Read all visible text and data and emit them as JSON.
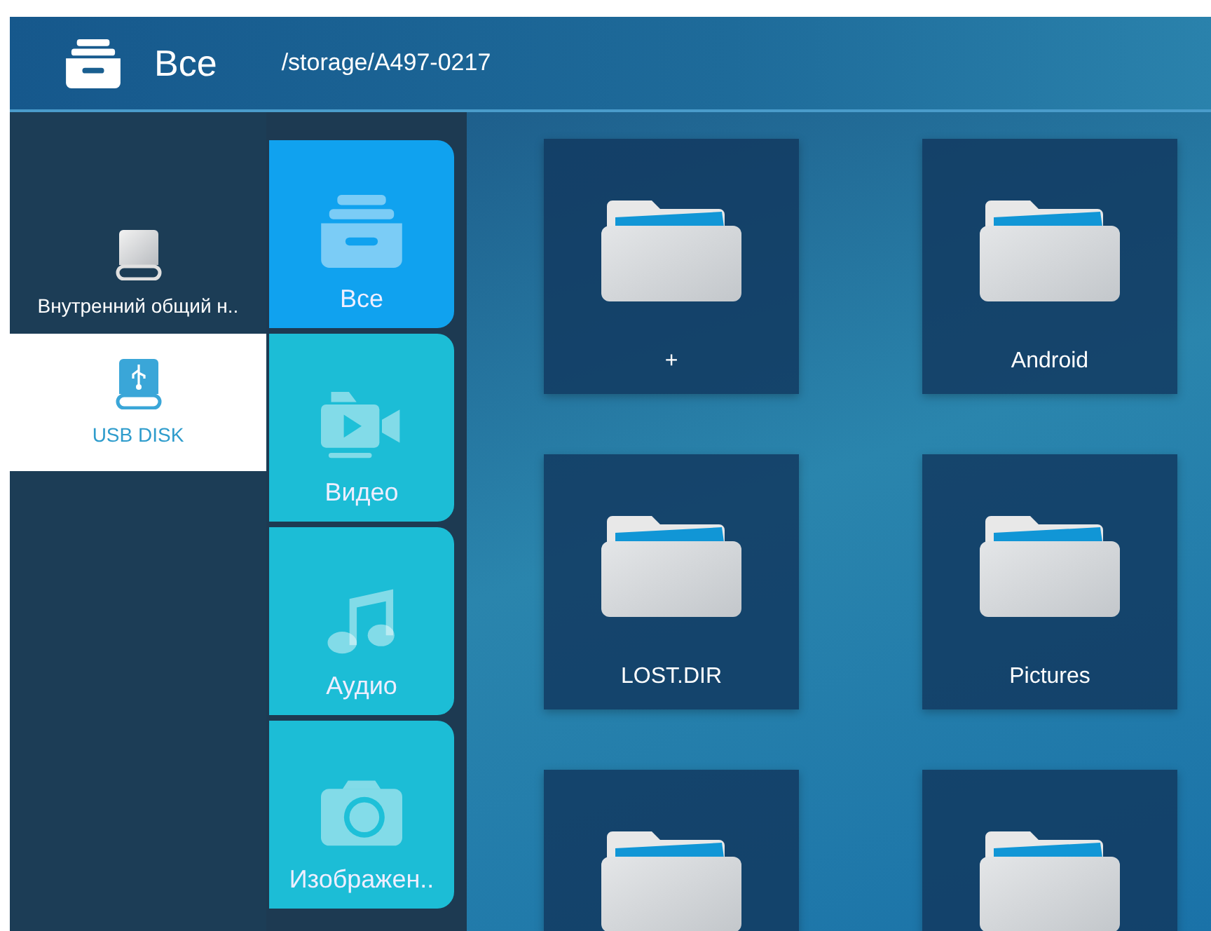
{
  "header": {
    "title": "Все",
    "path": "/storage/A497-0217"
  },
  "storage": [
    {
      "label": "Внутренний общий н..",
      "kind": "internal",
      "selected": false
    },
    {
      "label": "USB DISK",
      "kind": "usb",
      "selected": true
    }
  ],
  "categories": [
    {
      "label": "Все",
      "kind": "all",
      "selected": true
    },
    {
      "label": "Видео",
      "kind": "video",
      "selected": false
    },
    {
      "label": "Аудио",
      "kind": "audio",
      "selected": false
    },
    {
      "label": "Изображен..",
      "kind": "image",
      "selected": false
    }
  ],
  "folders": [
    {
      "kind": "folder",
      "name": "+"
    },
    {
      "kind": "folder",
      "name": "Android"
    },
    {
      "kind": "folder",
      "name": "LOST.DIR"
    },
    {
      "kind": "folder",
      "name": "Pictures"
    },
    {
      "kind": "folder"
    },
    {
      "kind": "folder"
    }
  ]
}
